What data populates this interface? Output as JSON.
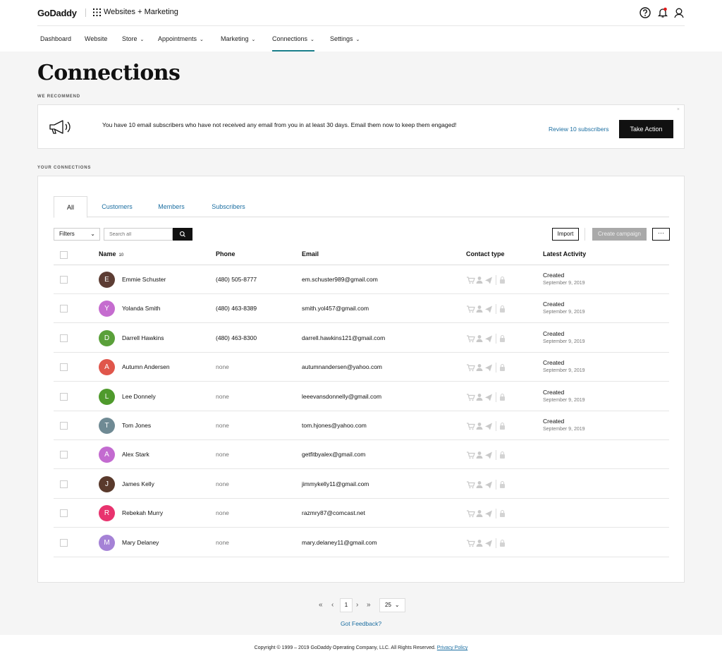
{
  "header": {
    "logo": "GoDaddy",
    "product": "Websites + Marketing"
  },
  "nav": [
    {
      "label": "Dashboard",
      "chev": ""
    },
    {
      "label": "Website",
      "chev": ""
    },
    {
      "label": "Store",
      "chev": "⌄"
    },
    {
      "label": "Appointments",
      "chev": "⌄"
    },
    {
      "label": "Marketing",
      "chev": "⌄"
    },
    {
      "label": "Connections",
      "chev": "⌄"
    },
    {
      "label": "Settings",
      "chev": "⌄"
    }
  ],
  "page_title": "Connections",
  "recommend": {
    "section_label": "WE RECOMMEND",
    "message": "You have 10 email subscribers who have not received any email from you in at least 30 days. Email them now to keep them engaged!",
    "link": "Review 10 subscribers",
    "button": "Take Action",
    "close": "×"
  },
  "connections": {
    "section_label": "YOUR CONNECTIONS",
    "tabs": [
      "All",
      "Customers",
      "Members",
      "Subscribers"
    ],
    "filters_label": "Filters",
    "search_placeholder": "Search all",
    "import_label": "Import",
    "campaign_label": "Create campaign",
    "more_label": "···",
    "columns": {
      "name": "Name",
      "count": "10",
      "phone": "Phone",
      "email": "Email",
      "contact_type": "Contact type",
      "activity": "Latest Activity"
    },
    "rows": [
      {
        "initial": "E",
        "color": "#5d3d34",
        "name": "Emmie Schuster",
        "phone": "(480) 505-8777",
        "email": "em.schuster989@gmail.com",
        "activity": "Created",
        "date": "September 9, 2019"
      },
      {
        "initial": "Y",
        "color": "#c56ccf",
        "name": "Yolanda Smith",
        "phone": "(480) 463-8389",
        "email": "smith.yol457@gmail.com",
        "activity": "Created",
        "date": "September 9, 2019"
      },
      {
        "initial": "D",
        "color": "#5aa03a",
        "name": "Darrell Hawkins",
        "phone": "(480) 463-8300",
        "email": "darrell.hawkins121@gmail.com",
        "activity": "Created",
        "date": "September 9, 2019"
      },
      {
        "initial": "A",
        "color": "#e0564b",
        "name": "Autumn Andersen",
        "phone": "none",
        "email": "autumnandersen@yahoo.com",
        "activity": "Created",
        "date": "September 9, 2019"
      },
      {
        "initial": "L",
        "color": "#4f9a2c",
        "name": "Lee Donnely",
        "phone": "none",
        "email": "leeevansdonnelly@gmail.com",
        "activity": "Created",
        "date": "September 9, 2019"
      },
      {
        "initial": "T",
        "color": "#6f8a94",
        "name": "Tom Jones",
        "phone": "none",
        "email": "tom.hjones@yahoo.com",
        "activity": "Created",
        "date": "September 9, 2019"
      },
      {
        "initial": "A",
        "color": "#c36bd0",
        "name": "Alex Stark",
        "phone": "none",
        "email": "getfitbyalex@gmail.com",
        "activity": "",
        "date": ""
      },
      {
        "initial": "J",
        "color": "#5a3a2c",
        "name": "James Kelly",
        "phone": "none",
        "email": "jimmykelly11@gmail.com",
        "activity": "",
        "date": ""
      },
      {
        "initial": "R",
        "color": "#e8336e",
        "name": "Rebekah Murry",
        "phone": "none",
        "email": "razmry87@comcast.net",
        "activity": "",
        "date": ""
      },
      {
        "initial": "M",
        "color": "#a582d6",
        "name": "Mary Delaney",
        "phone": "none",
        "email": "mary.delaney11@gmail.com",
        "activity": "",
        "date": ""
      }
    ]
  },
  "pagination": {
    "first": "«",
    "prev": "‹",
    "page": "1",
    "next": "›",
    "last": "»",
    "page_size": "25"
  },
  "feedback": "Got Feedback?",
  "footer": {
    "copyright": "Copyright © 1999 – 2019 GoDaddy Operating Company, LLC. All Rights Reserved.",
    "privacy": "Privacy Policy"
  }
}
